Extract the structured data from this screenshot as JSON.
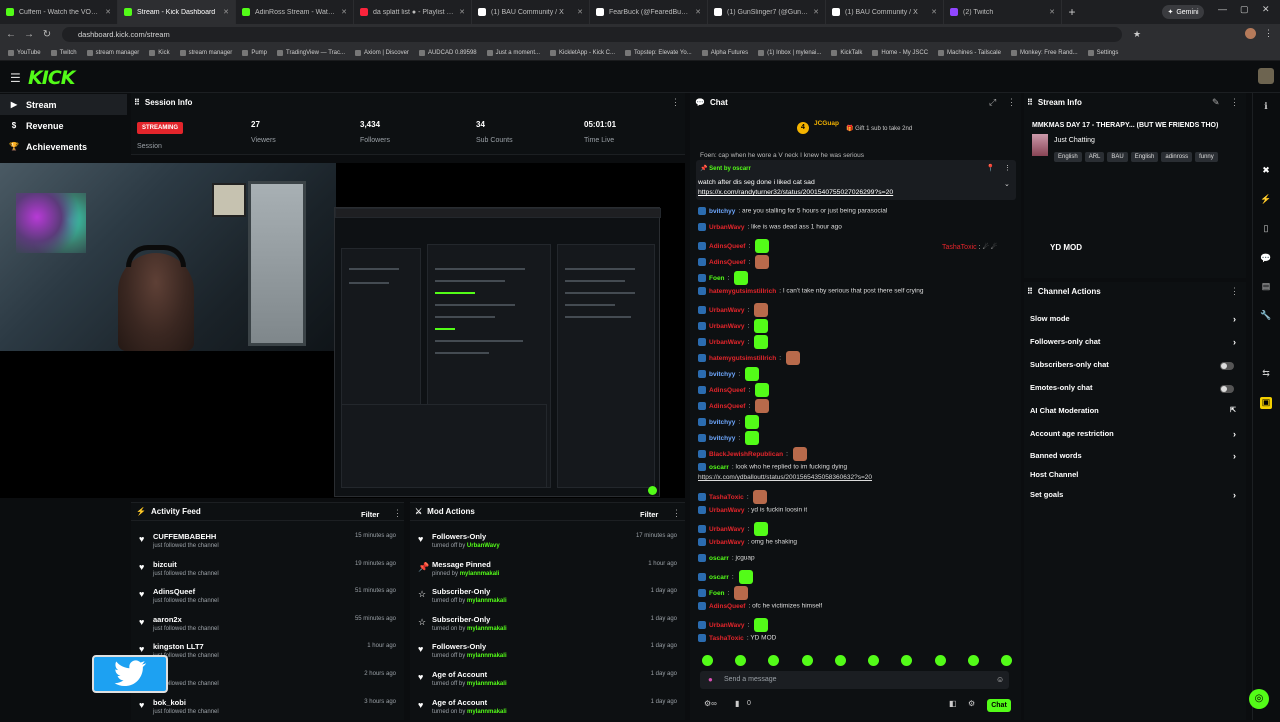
{
  "browser": {
    "tabs": [
      {
        "title": "Cuffem - Watch the VOD on Kick",
        "color": "#53fc18",
        "active": false
      },
      {
        "title": "Stream - Kick Dashboard",
        "color": "#53fc18",
        "active": true
      },
      {
        "title": "AdinRoss Stream - Watch Live o",
        "color": "#53fc18",
        "active": false
      },
      {
        "title": "da splatt list ● - Playlist - App",
        "color": "#fa243c",
        "active": false
      },
      {
        "title": "(1) BAU Community / X",
        "color": "#ffffff",
        "active": false
      },
      {
        "title": "FearBuck (@FearedBuck) / X",
        "color": "#ffffff",
        "active": false
      },
      {
        "title": "(1) GunSlinger7 (@GunSlinger...",
        "color": "#ffffff",
        "active": false
      },
      {
        "title": "(1) BAU Community / X",
        "color": "#ffffff",
        "active": false
      },
      {
        "title": "(2) Twitch",
        "color": "#9146ff",
        "active": false
      }
    ],
    "new_tab": "+",
    "gemini": "Gemini",
    "url": "dashboard.kick.com/stream",
    "bookmarks": [
      "YouTube",
      "Twitch",
      "stream manager",
      "Kick",
      "stream manager",
      "Pump",
      "TradingView — Trac...",
      "Axiom | Discover",
      "AUDCAD 0.89598",
      "Just a moment...",
      "KickletApp - Kick C...",
      "Topstep: Elevate Yo...",
      "Alpha Futures",
      "(1) Inbox | mylenai...",
      "KickTalk",
      "Home - My JSCC",
      "Machines - Tailscale",
      "Monkey: Free Rand...",
      "Settings"
    ]
  },
  "kick": {
    "logo": "KICK",
    "sidebar": [
      {
        "label": "Stream",
        "icon": "stream-icon",
        "active": true
      },
      {
        "label": "Revenue",
        "icon": "revenue-icon",
        "active": false
      },
      {
        "label": "Achievements",
        "icon": "trophy-icon",
        "active": false
      }
    ]
  },
  "session": {
    "title": "Session Info",
    "badge": "STREAMING",
    "badge_label": "Session",
    "stats": [
      {
        "value": "27",
        "label": "Viewers"
      },
      {
        "value": "3,434",
        "label": "Followers"
      },
      {
        "value": "34",
        "label": "Sub Counts"
      },
      {
        "value": "05:01:01",
        "label": "Time Live"
      }
    ]
  },
  "activity": {
    "title": "Activity Feed",
    "filter": "Filter",
    "items": [
      {
        "name": "CUFFEMBABEHH",
        "action": "just followed the channel",
        "time": "15 minutes ago"
      },
      {
        "name": "bizcuit",
        "action": "just followed the channel",
        "time": "19 minutes ago"
      },
      {
        "name": "AdinsQueef",
        "action": "just followed the channel",
        "time": "51 minutes ago"
      },
      {
        "name": "aaron2x",
        "action": "just followed the channel",
        "time": "55 minutes ago"
      },
      {
        "name": "kingston LLT7",
        "action": "just followed the channel",
        "time": "1 hour ago"
      },
      {
        "name": "_06",
        "action": "just followed the channel",
        "time": "2 hours ago"
      },
      {
        "name": "bok_kobi",
        "action": "just followed the channel",
        "time": "3 hours ago"
      }
    ]
  },
  "mod": {
    "title": "Mod Actions",
    "filter": "Filter",
    "items": [
      {
        "name": "Followers-Only",
        "prefix": "turned off by",
        "by": "UrbanWavy",
        "time": "17 minutes ago",
        "icon": "heart-icon"
      },
      {
        "name": "Message Pinned",
        "prefix": "pinned by",
        "by": "mylannmakali",
        "time": "1 hour ago",
        "icon": "pin-icon"
      },
      {
        "name": "Subscriber-Only",
        "prefix": "turned off by",
        "by": "mylannmakali",
        "time": "1 day ago",
        "icon": "star-icon"
      },
      {
        "name": "Subscriber-Only",
        "prefix": "turned on by",
        "by": "mylannmakali",
        "time": "1 day ago",
        "icon": "star-icon"
      },
      {
        "name": "Followers-Only",
        "prefix": "turned off by",
        "by": "mylannmakali",
        "time": "1 day ago",
        "icon": "heart-icon"
      },
      {
        "name": "Age of Account",
        "prefix": "turned off by",
        "by": "mylannmakali",
        "time": "1 day ago",
        "icon": "heart-icon"
      },
      {
        "name": "Age of Account",
        "prefix": "turned on by",
        "by": "mylannmakali",
        "time": "1 day ago",
        "icon": "heart-icon"
      }
    ]
  },
  "chat": {
    "title": "Chat",
    "goal_user": "JCGuap",
    "goal_count": "4",
    "goal_text": "Gift 1 sub to take 2nd",
    "pinned_by": "Sent by",
    "pinned_user": "oscarr",
    "pinned_text": "watch after dis seg done i liked cat sad",
    "pinned_link": "https://x.com/randyturner32/status/2001540755027026299?s=20",
    "top_cut": "Foen: cap when he wore a V neck I knew he was serious",
    "messages": [
      {
        "user": "bvitchyy",
        "color": "#6fa8ff",
        "text": "are you stalling for 5 hours or just being parasocial"
      },
      {
        "user": "UrbanWavy",
        "color": "#e3252b",
        "text": "like is was dead ass 1 hour ago"
      },
      {
        "user": "AdinsQueef",
        "color": "#e3252b",
        "text": ""
      },
      {
        "user": "AdinsQueef",
        "color": "#e3252b",
        "text": ""
      },
      {
        "user": "Foen",
        "color": "#53fc18",
        "text": ""
      },
      {
        "user": "hatemygutsimstillrich",
        "color": "#e3252b",
        "text": "I can't take nby serious that post there self crying"
      },
      {
        "user": "UrbanWavy",
        "color": "#e3252b",
        "text": ""
      },
      {
        "user": "UrbanWavy",
        "color": "#e3252b",
        "text": ""
      },
      {
        "user": "UrbanWavy",
        "color": "#e3252b",
        "text": ""
      },
      {
        "user": "hatemygutsimstillrich",
        "color": "#e3252b",
        "text": ""
      },
      {
        "user": "bvitchyy",
        "color": "#6fa8ff",
        "text": ""
      },
      {
        "user": "AdinsQueef",
        "color": "#e3252b",
        "text": ""
      },
      {
        "user": "AdinsQueef",
        "color": "#e3252b",
        "text": ""
      },
      {
        "user": "bvitchyy",
        "color": "#6fa8ff",
        "text": ""
      },
      {
        "user": "bvitchyy",
        "color": "#6fa8ff",
        "text": ""
      },
      {
        "user": "BlackJewishRepublican",
        "color": "#e3252b",
        "text": ""
      },
      {
        "user": "oscarr",
        "color": "#53fc18",
        "text": "look who he replied to im fucking dying"
      },
      {
        "user": "",
        "color": "#dcdcdc",
        "text": "https://x.com/ydballoutt/status/2001565435058360632?s=20"
      },
      {
        "user": "TashaToxic",
        "color": "#e3252b",
        "text": ""
      },
      {
        "user": "UrbanWavy",
        "color": "#e3252b",
        "text": "yd is fuckin loosin it"
      },
      {
        "user": "UrbanWavy",
        "color": "#e3252b",
        "text": ""
      },
      {
        "user": "UrbanWavy",
        "color": "#e3252b",
        "text": "omg he shaking"
      },
      {
        "user": "oscarr",
        "color": "#53fc18",
        "text": "jcguap"
      },
      {
        "user": "oscarr",
        "color": "#53fc18",
        "text": ""
      },
      {
        "user": "Foen",
        "color": "#53fc18",
        "text": ""
      },
      {
        "user": "AdinsQueef",
        "color": "#e3252b",
        "text": "ofc he victimizes himself"
      },
      {
        "user": "UrbanWavy",
        "color": "#e3252b",
        "text": ""
      },
      {
        "user": "TashaToxic",
        "color": "#e3252b",
        "text": "YD MOD"
      }
    ],
    "input_placeholder": "Send a message",
    "count": "0",
    "send": "Chat"
  },
  "stream_info": {
    "title": "Stream Info",
    "stream_title": "MMKMAS DAY 17 - THERAPY... (BUT WE FRIENDS THO)",
    "category": "Just Chatting",
    "tags": [
      "English",
      "ARL",
      "BAU",
      "English",
      "adinross",
      "funny"
    ],
    "floating_user": "TashaToxic",
    "floating_text": "YD MOD"
  },
  "channel_actions": {
    "title": "Channel Actions",
    "items": [
      {
        "label": "Slow mode",
        "kind": "arrow"
      },
      {
        "label": "Followers-only chat",
        "kind": "arrow"
      },
      {
        "label": "Subscribers-only chat",
        "kind": "toggle"
      },
      {
        "label": "Emotes-only chat",
        "kind": "toggle"
      },
      {
        "label": "AI Chat Moderation",
        "kind": "external"
      },
      {
        "label": "Account age restriction",
        "kind": "arrow"
      },
      {
        "label": "Banned words",
        "kind": "arrow"
      },
      {
        "label": "Host Channel",
        "kind": "none"
      },
      {
        "label": "Set goals",
        "kind": "arrow"
      }
    ]
  }
}
